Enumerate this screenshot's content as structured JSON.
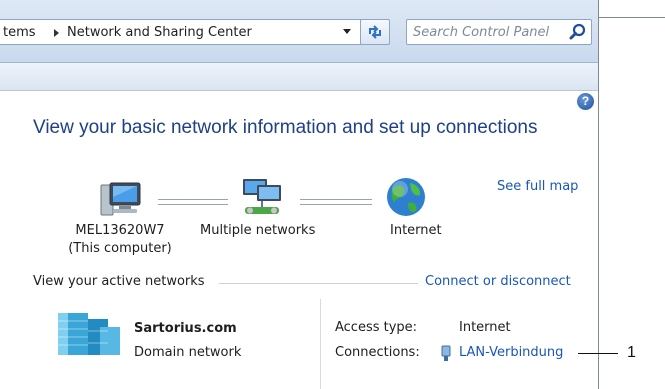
{
  "address_bar": {
    "breadcrumb_partial": "tems",
    "breadcrumb_current": "Network and Sharing Center",
    "search_placeholder": "Search Control Panel"
  },
  "help": {
    "label": "?"
  },
  "page": {
    "title": "View your basic network information and set up connections",
    "see_full_map": "See full map"
  },
  "network_map": {
    "computer": {
      "name": "MEL13620W7",
      "subtitle": "(This computer)"
    },
    "middle": {
      "name": "Multiple networks"
    },
    "internet": {
      "name": "Internet"
    }
  },
  "active_networks": {
    "section_label": "View your active networks",
    "connect_link": "Connect or disconnect",
    "network_name": "Sartorius.com",
    "network_type": "Domain network",
    "access_type_label": "Access type:",
    "access_type_value": "Internet",
    "connections_label": "Connections:",
    "connections_value": "LAN-Verbindung"
  },
  "callout": {
    "number": "1"
  },
  "colors": {
    "link": "#1a56b8",
    "title": "#1e3f8a",
    "chrome": "#c9d9ee"
  }
}
